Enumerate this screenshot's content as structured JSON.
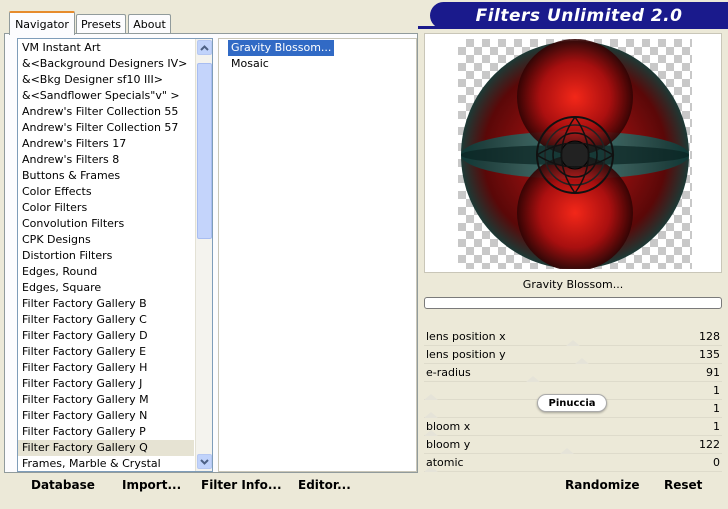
{
  "tabs": [
    {
      "label": "Navigator",
      "active": true
    },
    {
      "label": "Presets",
      "active": false
    },
    {
      "label": "About",
      "active": false
    }
  ],
  "banner": {
    "title": "Filters Unlimited 2.0"
  },
  "categories": [
    "VM Instant Art",
    "&<Background Designers IV>",
    "&<Bkg Designer sf10 III>",
    "&<Sandflower Specials\"v\" >",
    "Andrew's Filter Collection 55",
    "Andrew's Filter Collection 57",
    "Andrew's Filters 17",
    "Andrew's Filters 8",
    "Buttons & Frames",
    "Color Effects",
    "Color Filters",
    "Convolution Filters",
    "CPK Designs",
    "Distortion Filters",
    "Edges, Round",
    "Edges, Square",
    "Filter Factory Gallery B",
    "Filter Factory Gallery C",
    "Filter Factory Gallery D",
    "Filter Factory Gallery E",
    "Filter Factory Gallery H",
    "Filter Factory Gallery J",
    "Filter Factory Gallery M",
    "Filter Factory Gallery N",
    "Filter Factory Gallery P",
    "Filter Factory Gallery Q",
    "Frames, Marble & Crystal"
  ],
  "selected_category": "Filter Factory Gallery Q",
  "filters": [
    "Gravity Blossom...",
    "Mosaic"
  ],
  "selected_filter": "Gravity Blossom...",
  "preview": {
    "filter_name": "Gravity Blossom..."
  },
  "params": [
    {
      "label": "lens position x",
      "value": "128",
      "thumb": 0.5
    },
    {
      "label": "lens position y",
      "value": "135",
      "thumb": 0.53
    },
    {
      "label": "e-radius",
      "value": "91",
      "thumb": 0.36
    },
    {
      "label": "",
      "value": "1",
      "thumb": 0.0
    },
    {
      "label": "",
      "value": "1",
      "thumb": 0.0
    },
    {
      "label": "bloom x",
      "value": "1",
      "thumb": 0.0
    },
    {
      "label": "bloom y",
      "value": "122",
      "thumb": 0.48
    },
    {
      "label": "atomic",
      "value": "0",
      "thumb": 0.0
    }
  ],
  "watermark": "Pinuccia",
  "buttons": {
    "database": "Database",
    "import": "Import...",
    "filter_info": "Filter Info...",
    "editor": "Editor...",
    "randomize": "Randomize",
    "reset": "Reset"
  }
}
